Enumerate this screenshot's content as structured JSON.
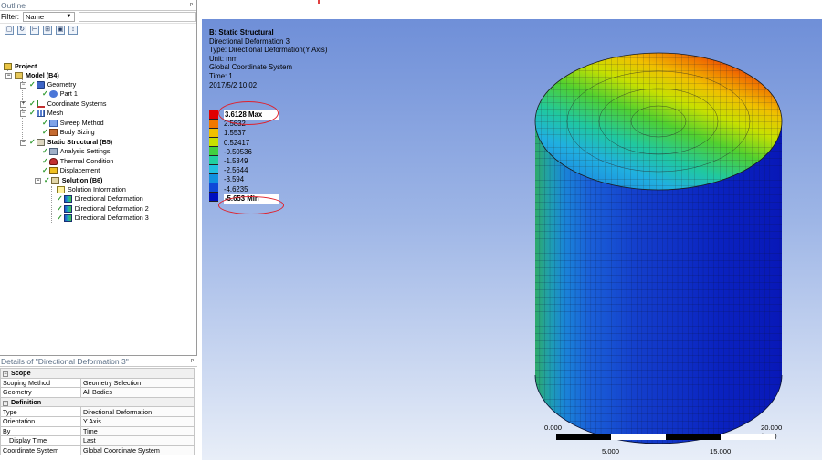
{
  "outline": {
    "title": "Outline",
    "pin": "ᵖ",
    "filter_label": "Filter:",
    "filter_value": "Name",
    "tree": [
      {
        "label": "Project",
        "icon": "project-icon"
      },
      {
        "label": "Model (B4)",
        "icon": "model-icon"
      },
      {
        "label": "Geometry",
        "icon": "geometry-icon"
      },
      {
        "label": "Part 1",
        "icon": "part-icon"
      },
      {
        "label": "Coordinate Systems",
        "icon": "coordinate-systems-icon"
      },
      {
        "label": "Mesh",
        "icon": "mesh-icon"
      },
      {
        "label": "Sweep Method",
        "icon": "sweep-method-icon"
      },
      {
        "label": "Body Sizing",
        "icon": "body-sizing-icon"
      },
      {
        "label": "Static Structural (B5)",
        "icon": "static-structural-icon"
      },
      {
        "label": "Analysis Settings",
        "icon": "analysis-settings-icon"
      },
      {
        "label": "Thermal Condition",
        "icon": "thermal-condition-icon"
      },
      {
        "label": "Displacement",
        "icon": "displacement-icon"
      },
      {
        "label": "Solution (B6)",
        "icon": "solution-icon"
      },
      {
        "label": "Solution Information",
        "icon": "solution-information-icon"
      },
      {
        "label": "Directional Deformation",
        "icon": "directional-deformation-icon"
      },
      {
        "label": "Directional Deformation 2",
        "icon": "directional-deformation-icon"
      },
      {
        "label": "Directional Deformation 3",
        "icon": "directional-deformation-icon"
      }
    ]
  },
  "details": {
    "title": "Details of \"Directional Deformation 3\"",
    "rows": [
      {
        "section": true,
        "key": "Scope"
      },
      {
        "key": "Scoping Method",
        "value": "Geometry Selection"
      },
      {
        "key": "Geometry",
        "value": "All Bodies"
      },
      {
        "section": true,
        "key": "Definition"
      },
      {
        "key": "Type",
        "value": "Directional Deformation"
      },
      {
        "key": "Orientation",
        "value": "Y Axis"
      },
      {
        "key": "By",
        "value": "Time"
      },
      {
        "key": "Display Time",
        "value": "Last"
      },
      {
        "key": "Coordinate System",
        "value": "Global Coordinate System"
      }
    ]
  },
  "viewport": {
    "info": [
      "B: Static Structural",
      "Directional Deformation 3",
      "Type: Directional Deformation(Y Axis)",
      "Unit: mm",
      "Global Coordinate System",
      "Time: 1",
      "2017/5/2 10:02"
    ],
    "legend": {
      "labels": [
        "3.6128 Max",
        "2.5832",
        "1.5537",
        "0.52417",
        "-0.50536",
        "-1.5349",
        "-2.5644",
        "-3.594",
        "-4.6235",
        "-5.653 Min"
      ],
      "colors": [
        "#e00000",
        "#f07800",
        "#f0c000",
        "#c8e000",
        "#40d040",
        "#20d0a0",
        "#20c0e0",
        "#1090e0",
        "#1048d8",
        "#0010c0"
      ]
    },
    "scale": {
      "start": "0.000",
      "end": "20.000 (mm)",
      "q1": "5.000",
      "q3": "15.000"
    }
  }
}
